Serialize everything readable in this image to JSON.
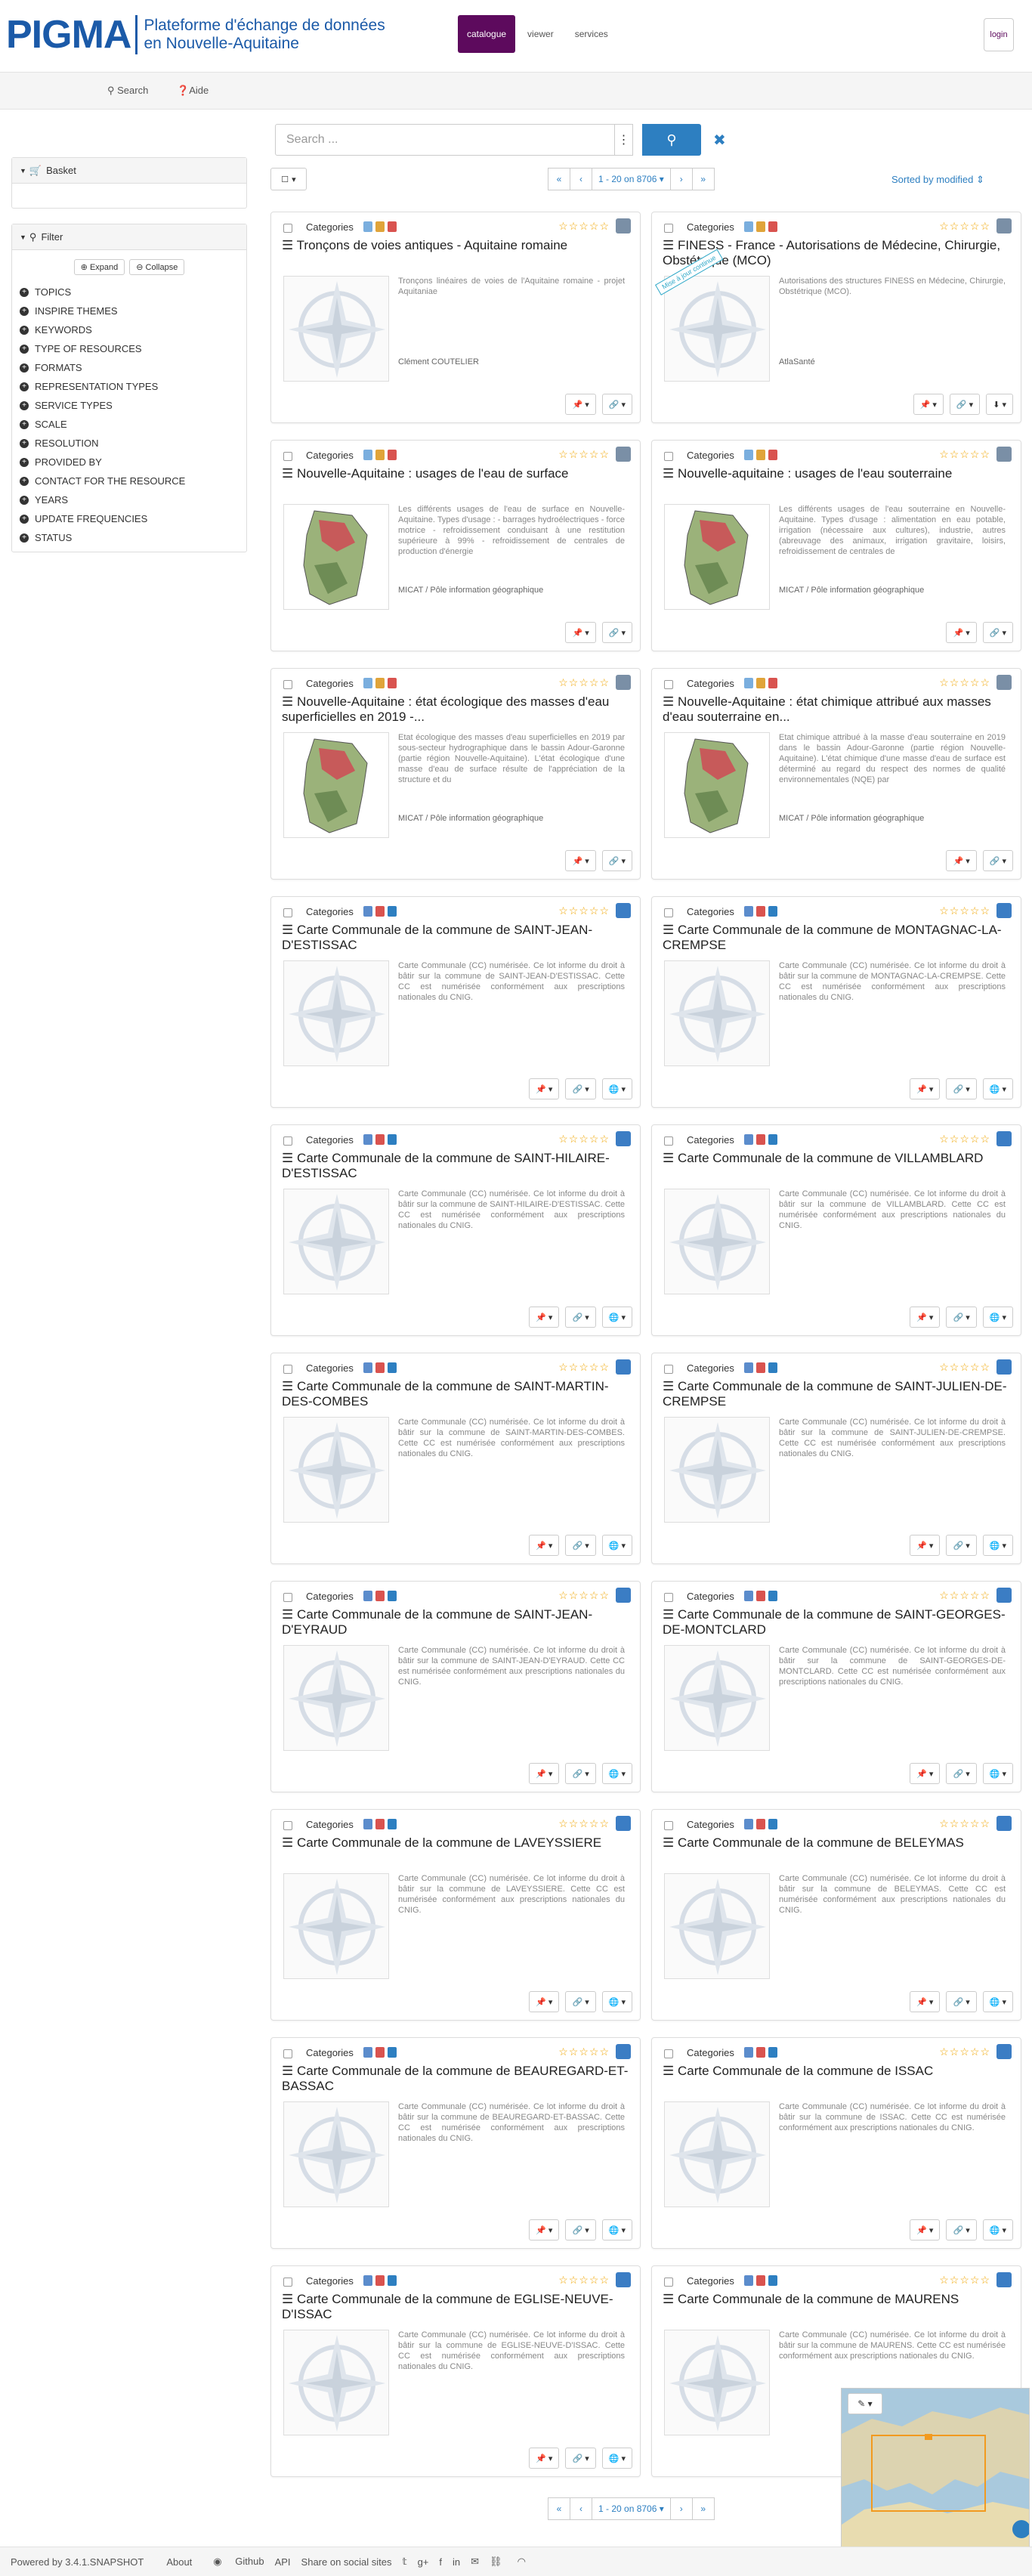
{
  "brand": {
    "logo_text": "PIGMA",
    "subtitle_line1": "Plateforme d'échange de données",
    "subtitle_line2": "en Nouvelle-Aquitaine"
  },
  "nav": {
    "tabs": [
      {
        "label": "catalogue"
      },
      {
        "label": "viewer"
      },
      {
        "label": "services"
      }
    ],
    "login_label": "login"
  },
  "subnav": {
    "search_label": "Search",
    "help_label": "Aide"
  },
  "sidebar": {
    "basket_label": "Basket",
    "filter_label": "Filter",
    "expand_label": "Expand",
    "collapse_label": "Collapse",
    "facets": [
      "TOPICS",
      "INSPIRE THEMES",
      "KEYWORDS",
      "TYPE OF RESOURCES",
      "FORMATS",
      "REPRESENTATION TYPES",
      "SERVICE TYPES",
      "SCALE",
      "RESOLUTION",
      "PROVIDED BY",
      "CONTACT FOR THE RESOURCE",
      "YEARS",
      "UPDATE FREQUENCIES",
      "STATUS"
    ]
  },
  "search": {
    "placeholder": "Search ..."
  },
  "pager": {
    "range": "1 - 20 on 8706",
    "sort": "Sorted by modified"
  },
  "common": {
    "categories_label": "Categories",
    "stars": "☆☆☆☆☆"
  },
  "records": [
    {
      "title": "Tronçons de voies antiques - Aquitaine romaine",
      "abstract": "Tronçons linéaires de voies de l'Aquitaine romaine - projet Aquitaniae",
      "org": "Clément COUTELIER",
      "thumb": "compass"
    },
    {
      "title": "FINESS - France - Autorisations de Médecine, Chirurgie, Obstétrique (MCO)",
      "abstract": "Autorisations des structures FINESS en Médecine, Chirurgie, Obstétrique (MCO).",
      "org": "AtlaSanté",
      "thumb": "compass",
      "ribbon": "Mise à jour continue"
    },
    {
      "title": "Nouvelle-Aquitaine : usages de l'eau de surface",
      "abstract": "Les différents usages de l'eau de surface en Nouvelle-Aquitaine. Types d'usage : - barrages hydroélectriques - force motrice - refroidissement conduisant à une restitution supérieure à 99% - refroidissement de centrales de production d'énergie",
      "org": "MICAT / Pôle information géographique",
      "thumb": "map"
    },
    {
      "title": "Nouvelle-aquitaine : usages de l'eau souterraine",
      "abstract": "Les différents usages de l'eau souterraine en Nouvelle-Aquitaine. Types d'usage : alimentation en eau potable, irrigation (nécessaire aux cultures), industrie, autres (abreuvage des animaux, irrigation gravitaire, loisirs, refroidissement de centrales de",
      "org": "MICAT / Pôle information géographique",
      "thumb": "map"
    },
    {
      "title": "Nouvelle-Aquitaine : état écologique des masses d'eau superficielles en 2019 -...",
      "abstract": "Etat écologique des masses d'eau superficielles en 2019 par sous-secteur hydrographique dans le bassin Adour-Garonne (partie région Nouvelle-Aquitaine). L'état écologique d'une masse d'eau de surface résulte de l'appréciation de la structure et du",
      "org": "MICAT / Pôle information géographique",
      "thumb": "map"
    },
    {
      "title": "Nouvelle-Aquitaine : état chimique attribué aux masses d'eau souterraine en...",
      "abstract": "Etat chimique attribué à la masse d'eau souterraine en 2019 dans le bassin Adour-Garonne (partie région Nouvelle-Aquitaine). L'état chimique d'une masse d'eau de surface est déterminé au regard du respect des normes de qualité environnementales (NQE) par",
      "org": "MICAT / Pôle information géographique",
      "thumb": "map"
    },
    {
      "title": "Carte Communale de la commune de SAINT-JEAN-D'ESTISSAC",
      "abstract": "Carte Communale (CC) numérisée. Ce lot informe du droit à bâtir sur la commune de SAINT-JEAN-D'ESTISSAC. Cette CC est numérisée conformément aux prescriptions nationales du CNIG.",
      "org": "",
      "thumb": "compass"
    },
    {
      "title": "Carte Communale de la commune de MONTAGNAC-LA-CREMPSE",
      "abstract": "Carte Communale (CC) numérisée. Ce lot informe du droit à bâtir sur la commune de MONTAGNAC-LA-CREMPSE. Cette CC est numérisée conformément aux prescriptions nationales du CNIG.",
      "org": "",
      "thumb": "compass"
    },
    {
      "title": "Carte Communale de la commune de SAINT-HILAIRE-D'ESTISSAC",
      "abstract": "Carte Communale (CC) numérisée. Ce lot informe du droit à bâtir sur la commune de SAINT-HILAIRE-D'ESTISSAC. Cette CC est numérisée conformément aux prescriptions nationales du CNIG.",
      "org": "",
      "thumb": "compass"
    },
    {
      "title": "Carte Communale de la commune de VILLAMBLARD",
      "abstract": "Carte Communale (CC) numérisée. Ce lot informe du droit à bâtir sur la commune de VILLAMBLARD. Cette CC est numérisée conformément aux prescriptions nationales du CNIG.",
      "org": "",
      "thumb": "compass"
    },
    {
      "title": "Carte Communale de la commune de SAINT-MARTIN-DES-COMBES",
      "abstract": "Carte Communale (CC) numérisée. Ce lot informe du droit à bâtir sur la commune de SAINT-MARTIN-DES-COMBES. Cette CC est numérisée conformément aux prescriptions nationales du CNIG.",
      "org": "",
      "thumb": "compass"
    },
    {
      "title": "Carte Communale de la commune de SAINT-JULIEN-DE-CREMPSE",
      "abstract": "Carte Communale (CC) numérisée. Ce lot informe du droit à bâtir sur la commune de SAINT-JULIEN-DE-CREMPSE. Cette CC est numérisée conformément aux prescriptions nationales du CNIG.",
      "org": "",
      "thumb": "compass"
    },
    {
      "title": "Carte Communale de la commune de SAINT-JEAN-D'EYRAUD",
      "abstract": "Carte Communale (CC) numérisée. Ce lot informe du droit à bâtir sur la commune de SAINT-JEAN-D'EYRAUD. Cette CC est numérisée conformément aux prescriptions nationales du CNIG.",
      "org": "",
      "thumb": "compass"
    },
    {
      "title": "Carte Communale de la commune de SAINT-GEORGES-DE-MONTCLARD",
      "abstract": "Carte Communale (CC) numérisée. Ce lot informe du droit à bâtir sur la commune de SAINT-GEORGES-DE-MONTCLARD. Cette CC est numérisée conformément aux prescriptions nationales du CNIG.",
      "org": "",
      "thumb": "compass"
    },
    {
      "title": "Carte Communale de la commune de LAVEYSSIERE",
      "abstract": "Carte Communale (CC) numérisée. Ce lot informe du droit à bâtir sur la commune de LAVEYSSIERE. Cette CC est numérisée conformément aux prescriptions nationales du CNIG.",
      "org": "",
      "thumb": "compass"
    },
    {
      "title": "Carte Communale de la commune de BELEYMAS",
      "abstract": "Carte Communale (CC) numérisée. Ce lot informe du droit à bâtir sur la commune de BELEYMAS. Cette CC est numérisée conformément aux prescriptions nationales du CNIG.",
      "org": "",
      "thumb": "compass"
    },
    {
      "title": "Carte Communale de la commune de BEAUREGARD-ET-BASSAC",
      "abstract": "Carte Communale (CC) numérisée. Ce lot informe du droit à bâtir sur la commune de BEAUREGARD-ET-BASSAC. Cette CC est numérisée conformément aux prescriptions nationales du CNIG.",
      "org": "",
      "thumb": "compass"
    },
    {
      "title": "Carte Communale de la commune de ISSAC",
      "abstract": "Carte Communale (CC) numérisée. Ce lot informe du droit à bâtir sur la commune de ISSAC. Cette CC est numérisée conformément aux prescriptions nationales du CNIG.",
      "org": "",
      "thumb": "compass"
    },
    {
      "title": "Carte Communale de la commune de EGLISE-NEUVE-D'ISSAC",
      "abstract": "Carte Communale (CC) numérisée. Ce lot informe du droit à bâtir sur la commune de EGLISE-NEUVE-D'ISSAC. Cette CC est numérisée conformément aux prescriptions nationales du CNIG.",
      "org": "",
      "thumb": "compass"
    },
    {
      "title": "Carte Communale de la commune de MAURENS",
      "abstract": "Carte Communale (CC) numérisée. Ce lot informe du droit à bâtir sur la commune de MAURENS. Cette CC est numérisée conformément aux prescriptions nationales du CNIG.",
      "org": "",
      "thumb": "compass"
    }
  ],
  "footer": {
    "powered": "Powered by 3.4.1.SNAPSHOT",
    "about": "About",
    "github": "Github",
    "api": "API",
    "share": "Share on social sites"
  }
}
